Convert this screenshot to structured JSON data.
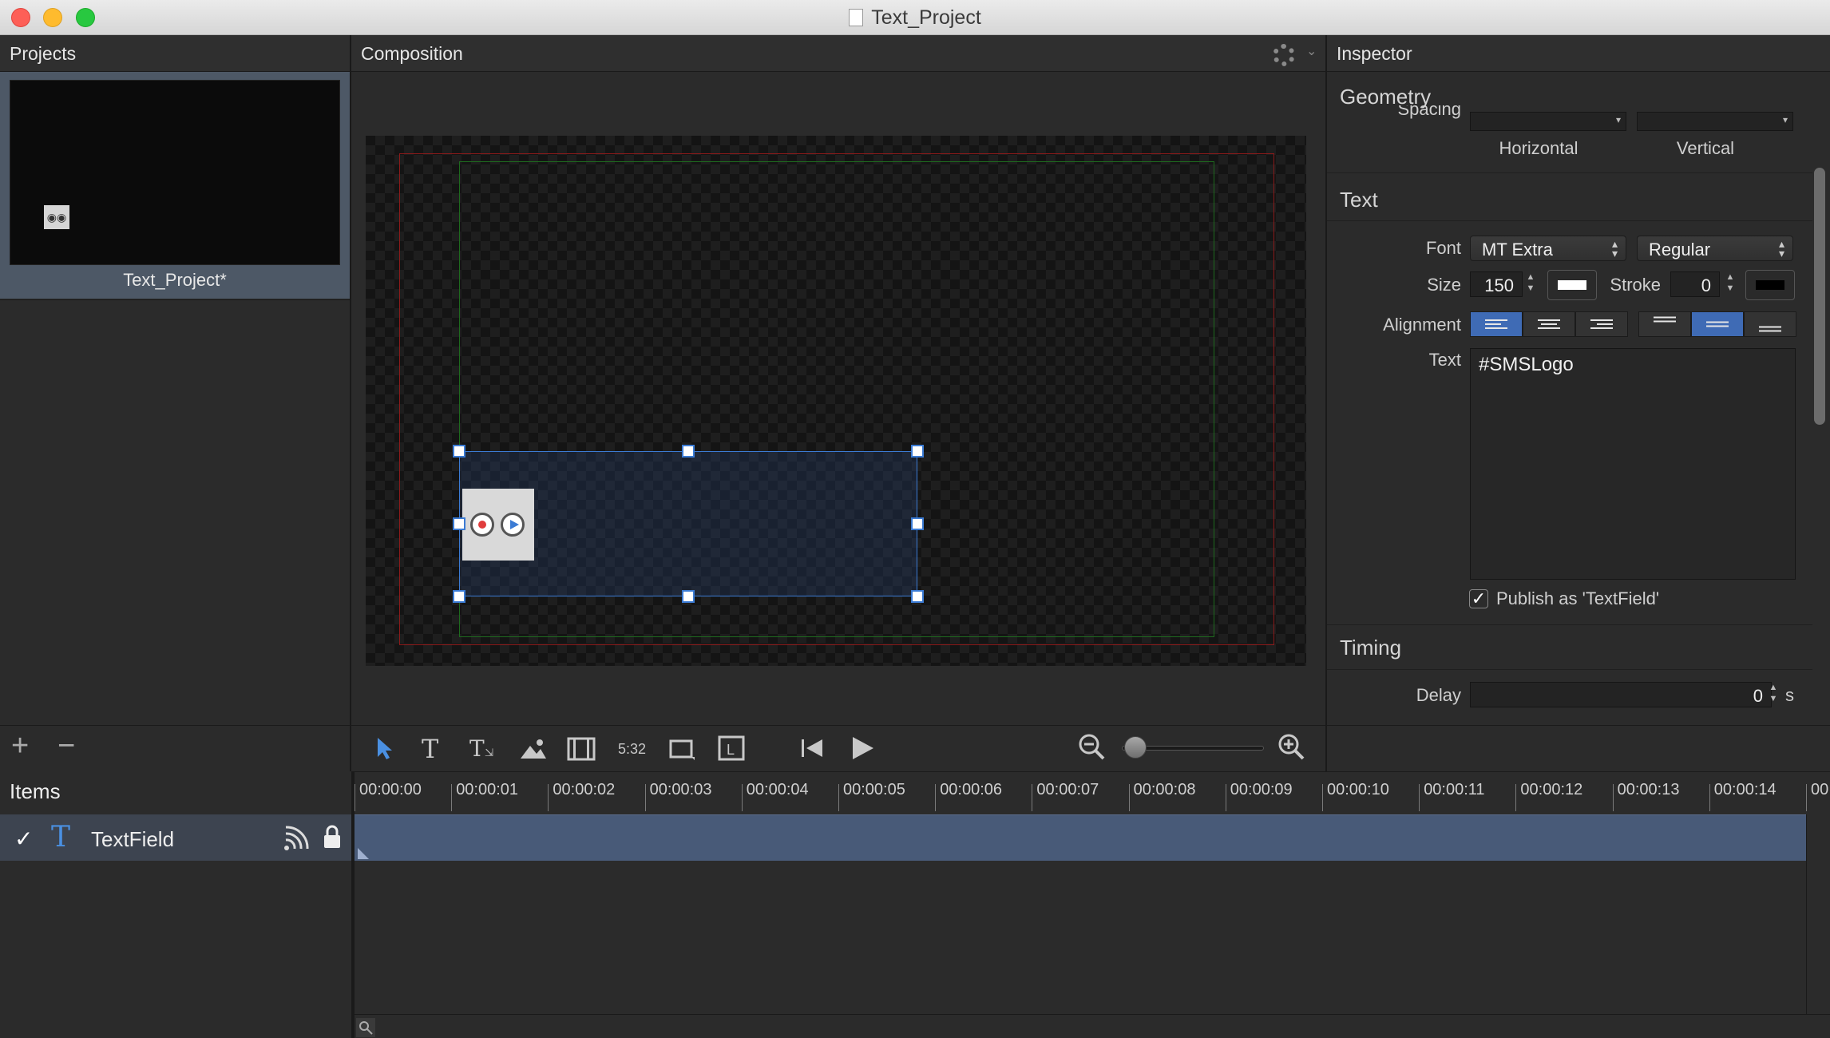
{
  "window": {
    "title": "Text_Project"
  },
  "projects": {
    "header": "Projects",
    "items": [
      {
        "name": "Text_Project*"
      }
    ],
    "add_label": "+",
    "remove_label": "−"
  },
  "composition": {
    "header": "Composition",
    "time_label": "5:32"
  },
  "inspector": {
    "header": "Inspector",
    "geometry": {
      "title": "Geometry",
      "spacing_label": "Spacing",
      "horizontal_label": "Horizontal",
      "vertical_label": "Vertical"
    },
    "text": {
      "title": "Text",
      "font_label": "Font",
      "font_family": "MT Extra",
      "font_style": "Regular",
      "size_label": "Size",
      "size_value": "150",
      "stroke_label": "Stroke",
      "stroke_value": "0",
      "fill_color": "#ffffff",
      "stroke_color": "#000000",
      "alignment_label": "Alignment",
      "horizontal_alignment": "left",
      "vertical_alignment": "center",
      "text_label": "Text",
      "text_value": "#SMSLogo",
      "publish_checked": true,
      "publish_label": "Publish as 'TextField'"
    },
    "timing": {
      "title": "Timing",
      "delay_label": "Delay",
      "delay_value": "0",
      "delay_unit": "s"
    }
  },
  "items": {
    "header": "Items",
    "rows": [
      {
        "name": "TextField",
        "checked": true,
        "icon": "text-T-icon"
      }
    ]
  },
  "timeline": {
    "ticks": [
      "00:00:00",
      "00:00:01",
      "00:00:02",
      "00:00:03",
      "00:00:04",
      "00:00:05",
      "00:00:06",
      "00:00:07",
      "00:00:08",
      "00:00:09",
      "00:00:10",
      "00:00:11",
      "00:00:12",
      "00:00:13",
      "00:00:14",
      "00"
    ]
  }
}
